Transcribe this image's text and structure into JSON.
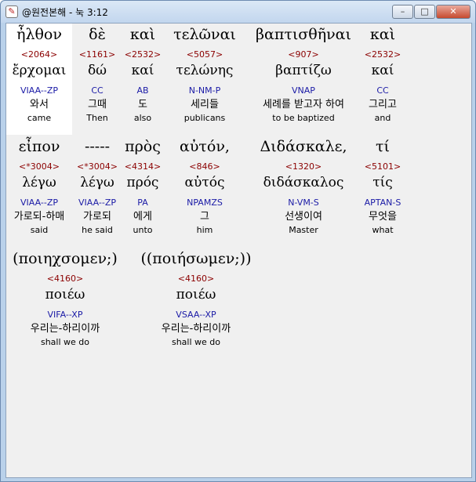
{
  "window": {
    "title": "@원전본해 - 눅 3:12",
    "icon": "app-book-icon",
    "buttons": {
      "minimize": "–",
      "maximize": "□",
      "close": "✕"
    }
  },
  "rows": [
    [
      {
        "greek": "ἦλθον",
        "strong": "<2064>",
        "lemma": "ἔρχομαι",
        "parse": "VIAA--ZP",
        "korean": "와서",
        "english": "came"
      },
      {
        "greek": "δὲ",
        "strong": "<1161>",
        "lemma": "δώ",
        "parse": "CC",
        "korean": "그때",
        "english": "Then"
      },
      {
        "greek": "καὶ",
        "strong": "<2532>",
        "lemma": "καί",
        "parse": "AB",
        "korean": "도",
        "english": "also"
      },
      {
        "greek": "τελῶναι",
        "strong": "<5057>",
        "lemma": "τελώνης",
        "parse": "N-NM-P",
        "korean": "세리들",
        "english": "publicans"
      },
      {
        "greek": "βαπτισθῆναι",
        "strong": "<907>",
        "lemma": "βαπτίζω",
        "parse": "VNAP",
        "korean": "세례를 받고자 하여",
        "english": "to be baptized"
      },
      {
        "greek": "καὶ",
        "strong": "<2532>",
        "lemma": "καί",
        "parse": "CC",
        "korean": "그리고",
        "english": "and"
      }
    ],
    [
      {
        "greek": "εἶπον",
        "strong": "<*3004>",
        "lemma": "λέγω",
        "parse": "VIAA--ZP",
        "korean": "가로되-하매",
        "english": "said"
      },
      {
        "greek": "-----",
        "strong": "<*3004>",
        "lemma": "λέγω",
        "parse": "VIAA--ZP",
        "korean": "가로되",
        "english": "he said"
      },
      {
        "greek": "πρὸς",
        "strong": "<4314>",
        "lemma": "πρός",
        "parse": "PA",
        "korean": "에게",
        "english": "unto"
      },
      {
        "greek": "αὐτόν,",
        "strong": "<846>",
        "lemma": "αὐτός",
        "parse": "NPAMZS",
        "korean": "그",
        "english": "him"
      },
      {
        "greek": "Διδάσκαλε,",
        "strong": "<1320>",
        "lemma": "διδάσκαλος",
        "parse": "N-VM-S",
        "korean": "선생이여",
        "english": "Master"
      },
      {
        "greek": "τί",
        "strong": "<5101>",
        "lemma": "τίς",
        "parse": "APTAN-S",
        "korean": "무엇을",
        "english": "what"
      }
    ],
    [
      {
        "greek": "(ποιηχσομεν;)",
        "strong": "<4160>",
        "lemma": "ποιέω",
        "parse": "VIFA--XP",
        "korean": "우리는-하리이까",
        "english": "shall we do"
      },
      {
        "greek": "((ποιήσωμεν;))",
        "strong": "<4160>",
        "lemma": "ποιέω",
        "parse": "VSAA--XP",
        "korean": "우리는-하리이까",
        "english": "shall we do"
      }
    ]
  ]
}
